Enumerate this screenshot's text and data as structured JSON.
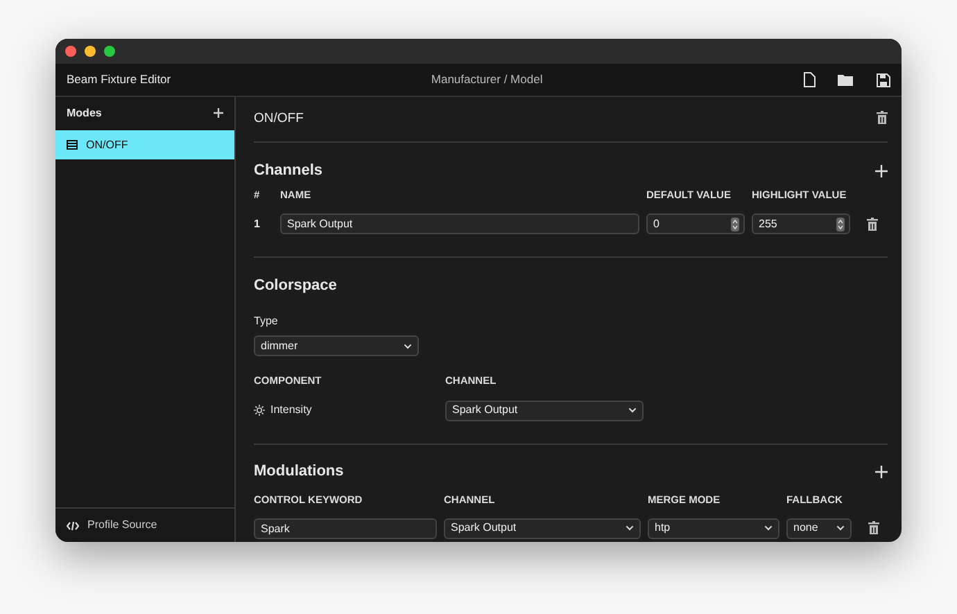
{
  "window": {
    "title": "Beam Fixture Editor",
    "breadcrumb": "Manufacturer / Model"
  },
  "sidebar": {
    "heading": "Modes",
    "items": [
      {
        "label": "ON/OFF",
        "selected": true
      }
    ],
    "footer_link": "Profile Source"
  },
  "mode": {
    "title": "ON/OFF"
  },
  "channels": {
    "heading": "Channels",
    "columns": [
      "#",
      "NAME",
      "DEFAULT VALUE",
      "HIGHLIGHT VALUE"
    ],
    "rows": [
      {
        "index": "1",
        "name": "Spark Output",
        "default_value": "0",
        "highlight_value": "255"
      }
    ]
  },
  "colorspace": {
    "heading": "Colorspace",
    "type_label": "Type",
    "type_value": "dimmer",
    "columns": [
      "COMPONENT",
      "CHANNEL"
    ],
    "rows": [
      {
        "component": "Intensity",
        "channel": "Spark Output"
      }
    ]
  },
  "modulations": {
    "heading": "Modulations",
    "columns": [
      "CONTROL KEYWORD",
      "CHANNEL",
      "MERGE MODE",
      "FALLBACK"
    ],
    "rows": [
      {
        "keyword": "Spark",
        "channel": "Spark Output",
        "merge_mode": "htp",
        "fallback": "none"
      }
    ]
  }
}
